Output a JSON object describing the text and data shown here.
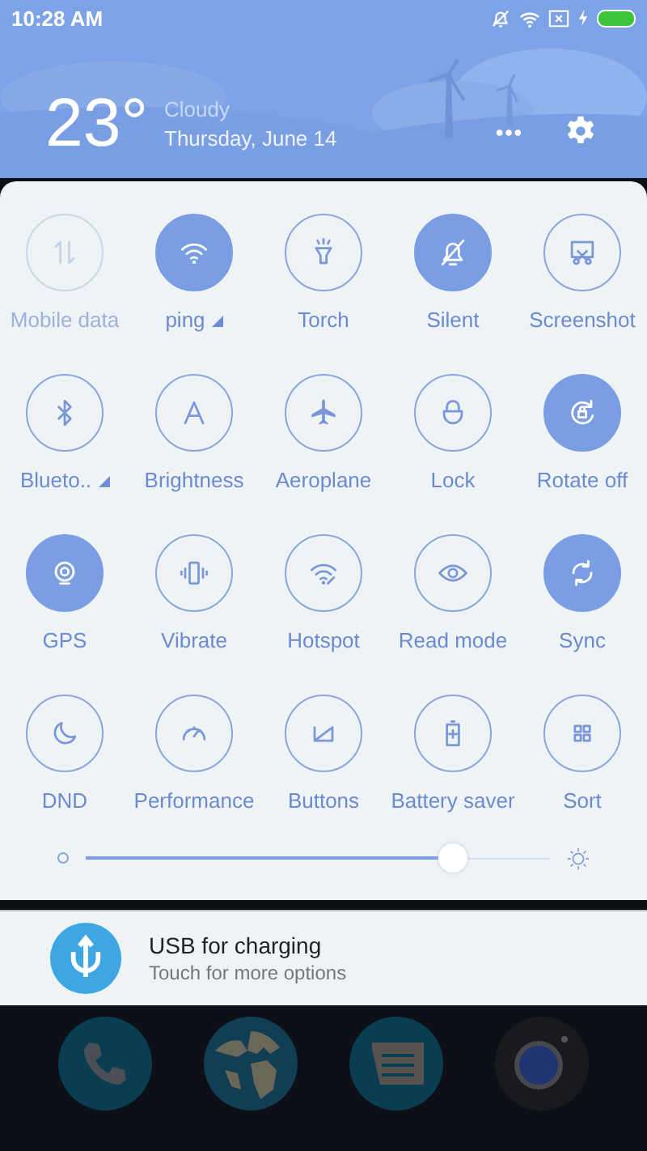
{
  "status_bar": {
    "time": "10:28 AM",
    "battery_charging": true
  },
  "weather": {
    "temperature": "23°",
    "condition": "Cloudy",
    "date": "Thursday, June 14"
  },
  "tiles": [
    {
      "label": "Mobile data",
      "on": false,
      "disabled": true,
      "expandable": false
    },
    {
      "label": "ping",
      "on": true,
      "disabled": false,
      "expandable": true
    },
    {
      "label": "Torch",
      "on": false,
      "disabled": false,
      "expandable": false
    },
    {
      "label": "Silent",
      "on": true,
      "disabled": false,
      "expandable": false
    },
    {
      "label": "Screenshot",
      "on": false,
      "disabled": false,
      "expandable": false
    },
    {
      "label": "Blueto..",
      "on": false,
      "disabled": false,
      "expandable": true
    },
    {
      "label": "Brightness",
      "on": false,
      "disabled": false,
      "expandable": false
    },
    {
      "label": "Aeroplane",
      "on": false,
      "disabled": false,
      "expandable": false
    },
    {
      "label": "Lock",
      "on": false,
      "disabled": false,
      "expandable": false
    },
    {
      "label": "Rotate off",
      "on": true,
      "disabled": false,
      "expandable": false
    },
    {
      "label": "GPS",
      "on": true,
      "disabled": false,
      "expandable": false
    },
    {
      "label": "Vibrate",
      "on": false,
      "disabled": false,
      "expandable": false
    },
    {
      "label": "Hotspot",
      "on": false,
      "disabled": false,
      "expandable": false
    },
    {
      "label": "Read mode",
      "on": false,
      "disabled": false,
      "expandable": false
    },
    {
      "label": "Sync",
      "on": true,
      "disabled": false,
      "expandable": false
    },
    {
      "label": "DND",
      "on": false,
      "disabled": false,
      "expandable": false
    },
    {
      "label": "Performance",
      "on": false,
      "disabled": false,
      "expandable": false
    },
    {
      "label": "Buttons",
      "on": false,
      "disabled": false,
      "expandable": false
    },
    {
      "label": "Battery saver",
      "on": false,
      "disabled": false,
      "expandable": false
    },
    {
      "label": "Sort",
      "on": false,
      "disabled": false,
      "expandable": false
    }
  ],
  "brightness": {
    "level": 0.79
  },
  "notification": {
    "title": "USB for charging",
    "text": "Touch for more options"
  }
}
